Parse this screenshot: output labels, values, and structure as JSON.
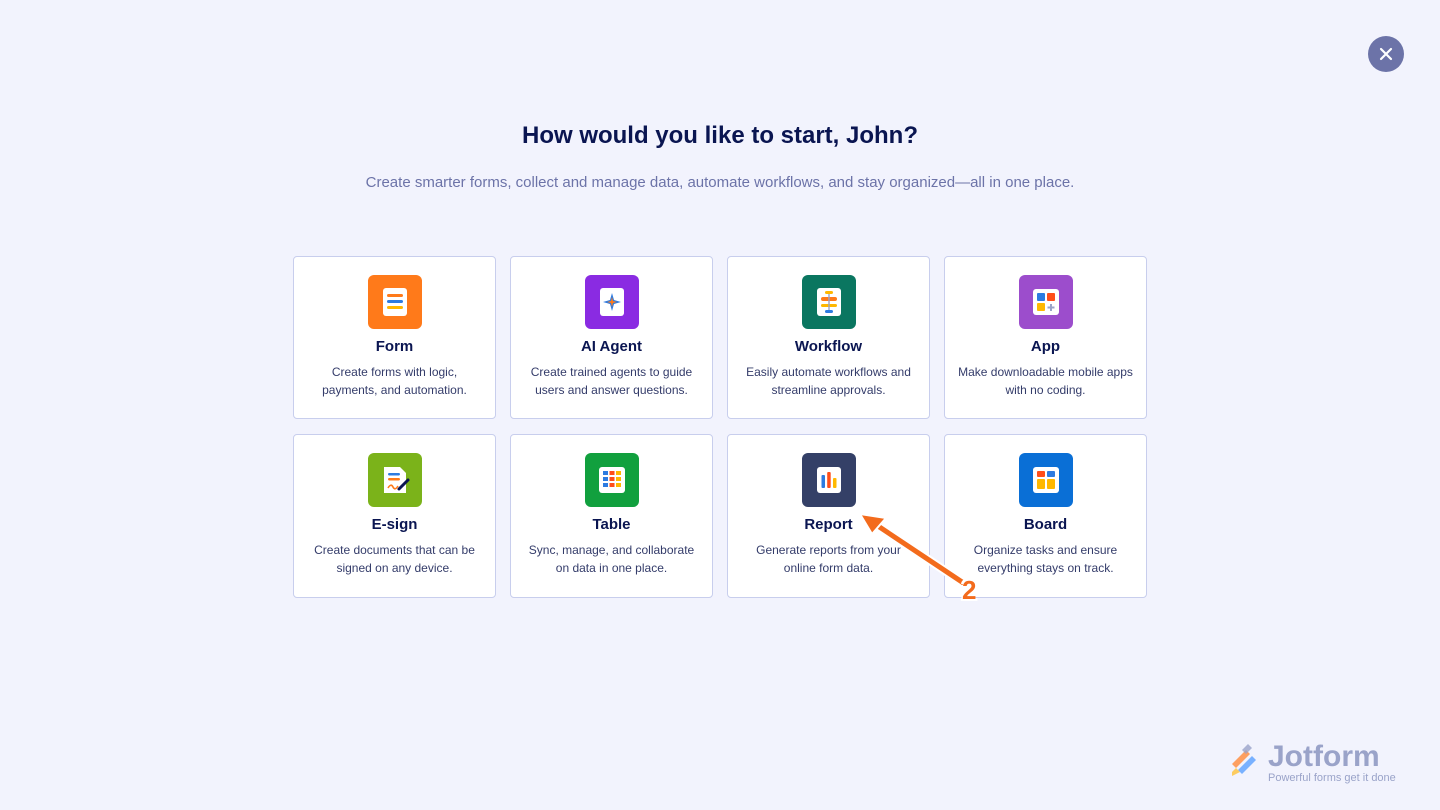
{
  "dialog": {
    "title": "How would you like to start, John?",
    "subtitle": "Create smarter forms, collect and manage data, automate workflows, and stay organized—all in one place."
  },
  "cards": [
    {
      "title": "Form",
      "desc": "Create forms with logic, payments, and automation.",
      "icon": "form-icon",
      "color": "#ff7a1a"
    },
    {
      "title": "AI Agent",
      "desc": "Create trained agents to guide users and answer questions.",
      "icon": "ai-agent-icon",
      "color": "#8a2be2"
    },
    {
      "title": "Workflow",
      "desc": "Easily automate workflows and streamline approvals.",
      "icon": "workflow-icon",
      "color": "#0a7660"
    },
    {
      "title": "App",
      "desc": "Make downloadable mobile apps with no coding.",
      "icon": "app-icon",
      "color": "#9c4dcc"
    },
    {
      "title": "E-sign",
      "desc": "Create documents that can be signed on any device.",
      "icon": "esign-icon",
      "color": "#7bb31a"
    },
    {
      "title": "Table",
      "desc": "Sync, manage, and collaborate on data in one place.",
      "icon": "table-icon",
      "color": "#11a03e"
    },
    {
      "title": "Report",
      "desc": "Generate reports from your online form data.",
      "icon": "report-icon",
      "color": "#344067"
    },
    {
      "title": "Board",
      "desc": "Organize tasks and ensure everything stays on track.",
      "icon": "board-icon",
      "color": "#0a6fd6"
    }
  ],
  "annotation": {
    "number": "2",
    "color": "#f36b1c"
  },
  "brand": {
    "name": "Jotform",
    "tagline": "Powerful forms get it done"
  },
  "close_icon": "close-icon"
}
